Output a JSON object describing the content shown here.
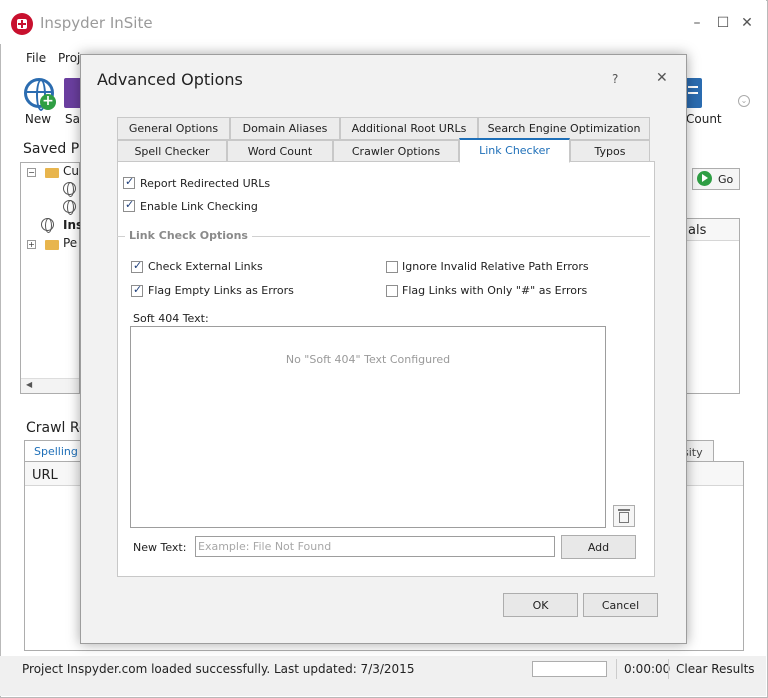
{
  "app": {
    "title": "Inspyder InSite",
    "window_controls": {
      "minimize": "–",
      "maximize": "☐",
      "close": "✕"
    }
  },
  "menu": {
    "file": "File",
    "project": "Proj"
  },
  "ribbon": {
    "new_label": "New",
    "save_label": "Sav",
    "count_label": "Count"
  },
  "saved_projects": {
    "label": "Saved Pr",
    "tree": [
      {
        "text": "Cu",
        "icon": "folder-icon"
      },
      {
        "text": "",
        "icon": "globe-icon"
      },
      {
        "text": "",
        "icon": "globe-icon"
      },
      {
        "text": "Ins",
        "icon": "globe-icon",
        "bold": true
      },
      {
        "text": "Pe",
        "icon": "folder-icon"
      }
    ]
  },
  "go_button": {
    "label": "Go"
  },
  "right_grid": {
    "column": "als"
  },
  "crawl_results": {
    "label": "Crawl Re",
    "tabs": [
      "Spelling Er",
      "sity"
    ],
    "columns": [
      "URL"
    ]
  },
  "status": {
    "message": "Project Inspyder.com loaded successfully. Last updated: 7/3/2015",
    "elapsed": "0:00:00",
    "clear_label": "Clear Results"
  },
  "dialog": {
    "title": "Advanced Options",
    "help": "?",
    "close": "✕",
    "tabs_row1": [
      "General Options",
      "Domain Aliases",
      "Additional Root URLs",
      "Search Engine Optimization"
    ],
    "tabs_row2": [
      "Spell Checker",
      "Word Count",
      "Crawler Options",
      "Link Checker",
      "Typos"
    ],
    "active_tab": "Link Checker",
    "options": [
      {
        "label": "Report Redirected URLs",
        "checked": true
      },
      {
        "label": "Enable Link Checking",
        "checked": true
      }
    ],
    "link_check_options": {
      "title": "Link Check Options",
      "check_external_links": {
        "label": "Check External Links",
        "checked": true
      },
      "flag_empty_links": {
        "label": "Flag Empty Links as Errors",
        "checked": true
      },
      "ignore_invalid_relative": {
        "label": "Ignore Invalid Relative Path Errors",
        "checked": false
      },
      "flag_hash_links": {
        "label": "Flag Links with Only \"#\" as Errors",
        "checked": false
      }
    },
    "soft404": {
      "label": "Soft 404 Text:",
      "empty_text": "No \"Soft 404\" Text Configured",
      "new_text_label": "New Text:",
      "new_text_placeholder": "Example: File Not Found",
      "new_text_value": "",
      "add_label": "Add"
    },
    "ok_label": "OK",
    "cancel_label": "Cancel"
  }
}
